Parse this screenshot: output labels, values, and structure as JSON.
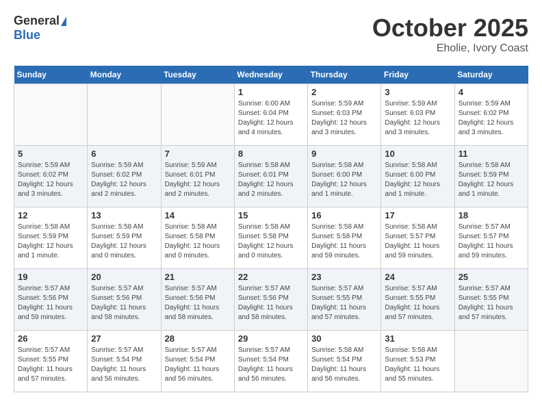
{
  "header": {
    "logo_general": "General",
    "logo_blue": "Blue",
    "month": "October 2025",
    "location": "Eholie, Ivory Coast"
  },
  "weekdays": [
    "Sunday",
    "Monday",
    "Tuesday",
    "Wednesday",
    "Thursday",
    "Friday",
    "Saturday"
  ],
  "weeks": [
    [
      {
        "day": "",
        "info": ""
      },
      {
        "day": "",
        "info": ""
      },
      {
        "day": "",
        "info": ""
      },
      {
        "day": "1",
        "info": "Sunrise: 6:00 AM\nSunset: 6:04 PM\nDaylight: 12 hours\nand 4 minutes."
      },
      {
        "day": "2",
        "info": "Sunrise: 5:59 AM\nSunset: 6:03 PM\nDaylight: 12 hours\nand 3 minutes."
      },
      {
        "day": "3",
        "info": "Sunrise: 5:59 AM\nSunset: 6:03 PM\nDaylight: 12 hours\nand 3 minutes."
      },
      {
        "day": "4",
        "info": "Sunrise: 5:59 AM\nSunset: 6:02 PM\nDaylight: 12 hours\nand 3 minutes."
      }
    ],
    [
      {
        "day": "5",
        "info": "Sunrise: 5:59 AM\nSunset: 6:02 PM\nDaylight: 12 hours\nand 3 minutes."
      },
      {
        "day": "6",
        "info": "Sunrise: 5:59 AM\nSunset: 6:02 PM\nDaylight: 12 hours\nand 2 minutes."
      },
      {
        "day": "7",
        "info": "Sunrise: 5:59 AM\nSunset: 6:01 PM\nDaylight: 12 hours\nand 2 minutes."
      },
      {
        "day": "8",
        "info": "Sunrise: 5:58 AM\nSunset: 6:01 PM\nDaylight: 12 hours\nand 2 minutes."
      },
      {
        "day": "9",
        "info": "Sunrise: 5:58 AM\nSunset: 6:00 PM\nDaylight: 12 hours\nand 1 minute."
      },
      {
        "day": "10",
        "info": "Sunrise: 5:58 AM\nSunset: 6:00 PM\nDaylight: 12 hours\nand 1 minute."
      },
      {
        "day": "11",
        "info": "Sunrise: 5:58 AM\nSunset: 5:59 PM\nDaylight: 12 hours\nand 1 minute."
      }
    ],
    [
      {
        "day": "12",
        "info": "Sunrise: 5:58 AM\nSunset: 5:59 PM\nDaylight: 12 hours\nand 1 minute."
      },
      {
        "day": "13",
        "info": "Sunrise: 5:58 AM\nSunset: 5:59 PM\nDaylight: 12 hours\nand 0 minutes."
      },
      {
        "day": "14",
        "info": "Sunrise: 5:58 AM\nSunset: 5:58 PM\nDaylight: 12 hours\nand 0 minutes."
      },
      {
        "day": "15",
        "info": "Sunrise: 5:58 AM\nSunset: 5:58 PM\nDaylight: 12 hours\nand 0 minutes."
      },
      {
        "day": "16",
        "info": "Sunrise: 5:58 AM\nSunset: 5:58 PM\nDaylight: 11 hours\nand 59 minutes."
      },
      {
        "day": "17",
        "info": "Sunrise: 5:58 AM\nSunset: 5:57 PM\nDaylight: 11 hours\nand 59 minutes."
      },
      {
        "day": "18",
        "info": "Sunrise: 5:57 AM\nSunset: 5:57 PM\nDaylight: 11 hours\nand 59 minutes."
      }
    ],
    [
      {
        "day": "19",
        "info": "Sunrise: 5:57 AM\nSunset: 5:56 PM\nDaylight: 11 hours\nand 59 minutes."
      },
      {
        "day": "20",
        "info": "Sunrise: 5:57 AM\nSunset: 5:56 PM\nDaylight: 11 hours\nand 58 minutes."
      },
      {
        "day": "21",
        "info": "Sunrise: 5:57 AM\nSunset: 5:56 PM\nDaylight: 11 hours\nand 58 minutes."
      },
      {
        "day": "22",
        "info": "Sunrise: 5:57 AM\nSunset: 5:56 PM\nDaylight: 11 hours\nand 58 minutes."
      },
      {
        "day": "23",
        "info": "Sunrise: 5:57 AM\nSunset: 5:55 PM\nDaylight: 11 hours\nand 57 minutes."
      },
      {
        "day": "24",
        "info": "Sunrise: 5:57 AM\nSunset: 5:55 PM\nDaylight: 11 hours\nand 57 minutes."
      },
      {
        "day": "25",
        "info": "Sunrise: 5:57 AM\nSunset: 5:55 PM\nDaylight: 11 hours\nand 57 minutes."
      }
    ],
    [
      {
        "day": "26",
        "info": "Sunrise: 5:57 AM\nSunset: 5:55 PM\nDaylight: 11 hours\nand 57 minutes."
      },
      {
        "day": "27",
        "info": "Sunrise: 5:57 AM\nSunset: 5:54 PM\nDaylight: 11 hours\nand 56 minutes."
      },
      {
        "day": "28",
        "info": "Sunrise: 5:57 AM\nSunset: 5:54 PM\nDaylight: 11 hours\nand 56 minutes."
      },
      {
        "day": "29",
        "info": "Sunrise: 5:57 AM\nSunset: 5:54 PM\nDaylight: 11 hours\nand 56 minutes."
      },
      {
        "day": "30",
        "info": "Sunrise: 5:58 AM\nSunset: 5:54 PM\nDaylight: 11 hours\nand 56 minutes."
      },
      {
        "day": "31",
        "info": "Sunrise: 5:58 AM\nSunset: 5:53 PM\nDaylight: 11 hours\nand 55 minutes."
      },
      {
        "day": "",
        "info": ""
      }
    ]
  ]
}
